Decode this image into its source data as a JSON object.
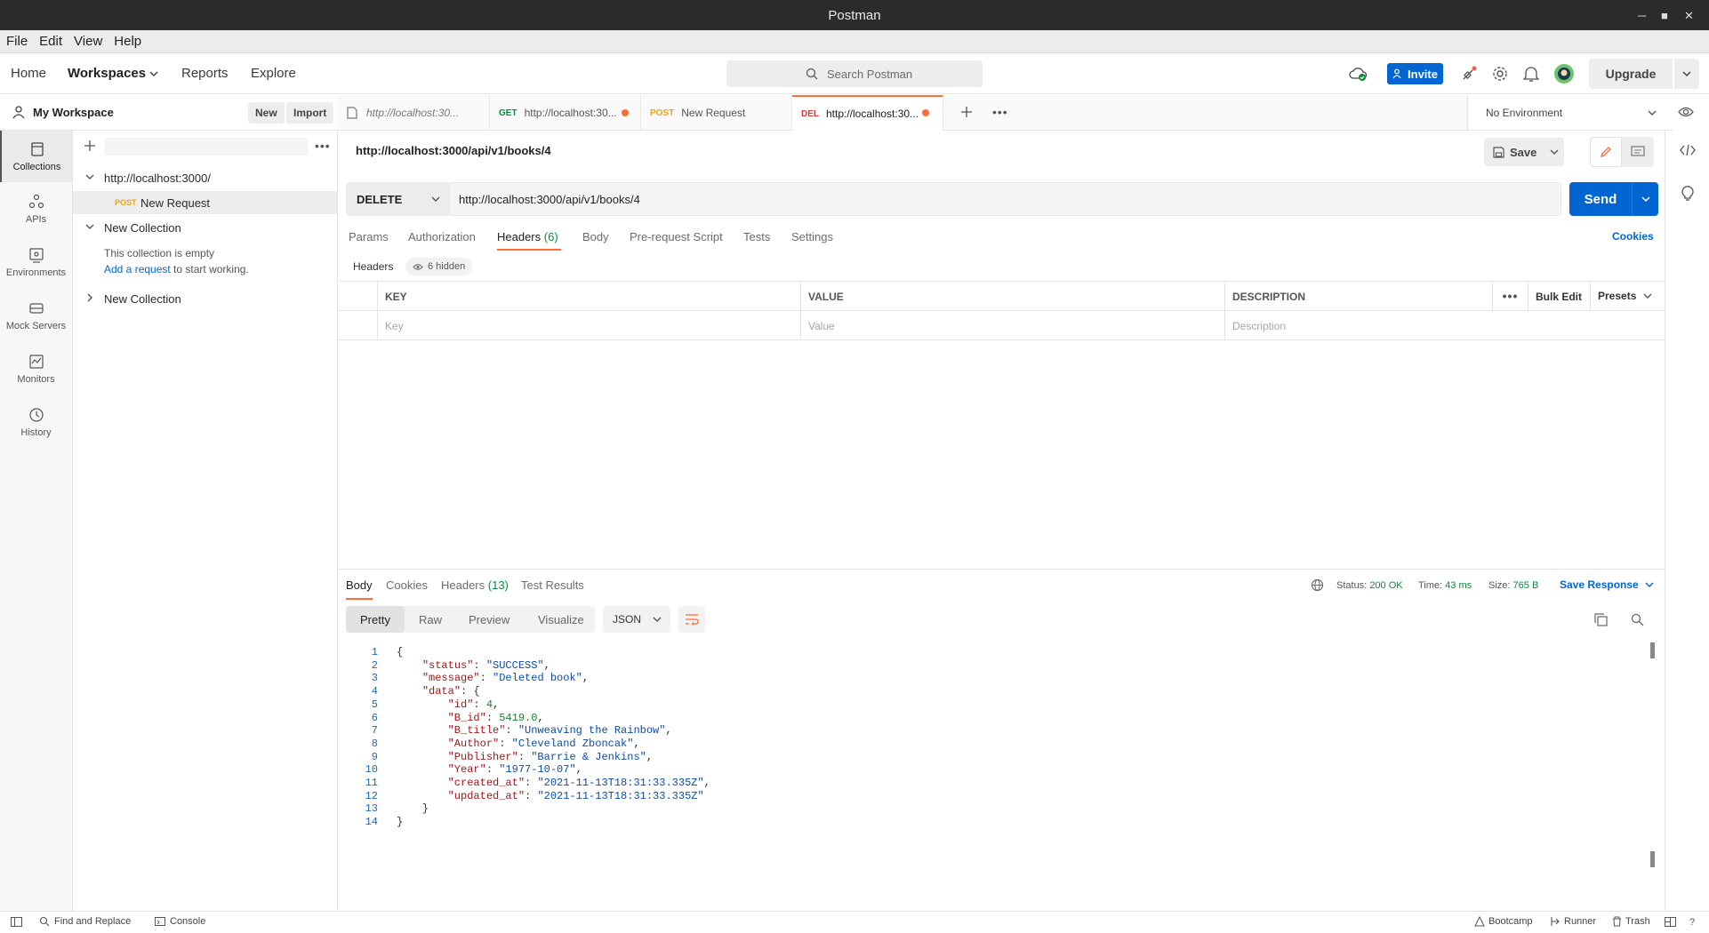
{
  "window": {
    "title": "Postman"
  },
  "menu": [
    "File",
    "Edit",
    "View",
    "Help"
  ],
  "header": {
    "nav": {
      "home": "Home",
      "workspaces": "Workspaces",
      "reports": "Reports",
      "explore": "Explore"
    },
    "search_placeholder": "Search Postman",
    "invite": "Invite",
    "upgrade": "Upgrade"
  },
  "workspace": {
    "name": "My Workspace",
    "new": "New",
    "import": "Import"
  },
  "rail": [
    "Collections",
    "APIs",
    "Environments",
    "Mock Servers",
    "Monitors",
    "History"
  ],
  "tree": {
    "collection1": "http://localhost:3000/",
    "request_method": "POST",
    "request_name": "New Request",
    "collection2": "New Collection",
    "empty_text": "This collection is empty",
    "add_link": "Add a request",
    "add_suffix": " to start working.",
    "collection3": "New Collection"
  },
  "tabs": [
    {
      "method": "",
      "label": "http://localhost:30..."
    },
    {
      "method": "GET",
      "label": "http://localhost:30..."
    },
    {
      "method": "POST",
      "label": "New Request"
    },
    {
      "method": "DEL",
      "label": "http://localhost:30..."
    }
  ],
  "environment": "No Environment",
  "request": {
    "title": "http://localhost:3000/api/v1/books/4",
    "save": "Save",
    "method": "DELETE",
    "url": "http://localhost:3000/api/v1/books/4",
    "send": "Send",
    "subtabs": {
      "params": "Params",
      "authorization": "Authorization",
      "headers": "Headers",
      "headers_count": "(6)",
      "body": "Body",
      "prerequest": "Pre-request Script",
      "tests": "Tests",
      "settings": "Settings"
    },
    "cookies": "Cookies",
    "headers_label": "Headers",
    "hidden_label": "6 hidden",
    "table": {
      "key": "KEY",
      "value": "VALUE",
      "description": "DESCRIPTION",
      "bulk_edit": "Bulk Edit",
      "presets": "Presets",
      "key_ph": "Key",
      "value_ph": "Value",
      "desc_ph": "Description"
    }
  },
  "response": {
    "tabs": {
      "body": "Body",
      "cookies": "Cookies",
      "headers": "Headers",
      "headers_count": "(13)",
      "tests": "Test Results"
    },
    "status_label": "Status:",
    "status_value": "200 OK",
    "time_label": "Time:",
    "time_value": "43 ms",
    "size_label": "Size:",
    "size_value": "765 B",
    "save_response": "Save Response",
    "views": {
      "pretty": "Pretty",
      "raw": "Raw",
      "preview": "Preview",
      "visualize": "Visualize"
    },
    "format": "JSON",
    "lines": [
      {
        "n": "1",
        "indent": 0,
        "text": "{"
      },
      {
        "n": "2",
        "indent": 1,
        "key": "\"status\"",
        "val": "\"SUCCESS\"",
        "type": "s",
        "tail": ","
      },
      {
        "n": "3",
        "indent": 1,
        "key": "\"message\"",
        "val": "\"Deleted book\"",
        "type": "s",
        "tail": ","
      },
      {
        "n": "4",
        "indent": 1,
        "key": "\"data\"",
        "val": "{",
        "type": "p",
        "tail": ""
      },
      {
        "n": "5",
        "indent": 2,
        "key": "\"id\"",
        "val": "4",
        "type": "n",
        "tail": ","
      },
      {
        "n": "6",
        "indent": 2,
        "key": "\"B_id\"",
        "val": "5419.0",
        "type": "n",
        "tail": ","
      },
      {
        "n": "7",
        "indent": 2,
        "key": "\"B_title\"",
        "val": "\"Unweaving the Rainbow\"",
        "type": "s",
        "tail": ","
      },
      {
        "n": "8",
        "indent": 2,
        "key": "\"Author\"",
        "val": "\"Cleveland Zboncak\"",
        "type": "s",
        "tail": ","
      },
      {
        "n": "9",
        "indent": 2,
        "key": "\"Publisher\"",
        "val": "\"Barrie & Jenkins\"",
        "type": "s",
        "tail": ","
      },
      {
        "n": "10",
        "indent": 2,
        "key": "\"Year\"",
        "val": "\"1977-10-07\"",
        "type": "s",
        "tail": ","
      },
      {
        "n": "11",
        "indent": 2,
        "key": "\"created_at\"",
        "val": "\"2021-11-13T18:31:33.335Z\"",
        "type": "s",
        "tail": ","
      },
      {
        "n": "12",
        "indent": 2,
        "key": "\"updated_at\"",
        "val": "\"2021-11-13T18:31:33.335Z\"",
        "type": "s",
        "tail": ""
      },
      {
        "n": "13",
        "indent": 1,
        "text": "}"
      },
      {
        "n": "14",
        "indent": 0,
        "text": "}"
      }
    ]
  },
  "statusbar": {
    "find": "Find and Replace",
    "console": "Console",
    "bootcamp": "Bootcamp",
    "runner": "Runner",
    "trash": "Trash"
  },
  "colors": {
    "accent": "#ff6c37",
    "primary": "#0265d2",
    "success": "#0a8a3a"
  }
}
